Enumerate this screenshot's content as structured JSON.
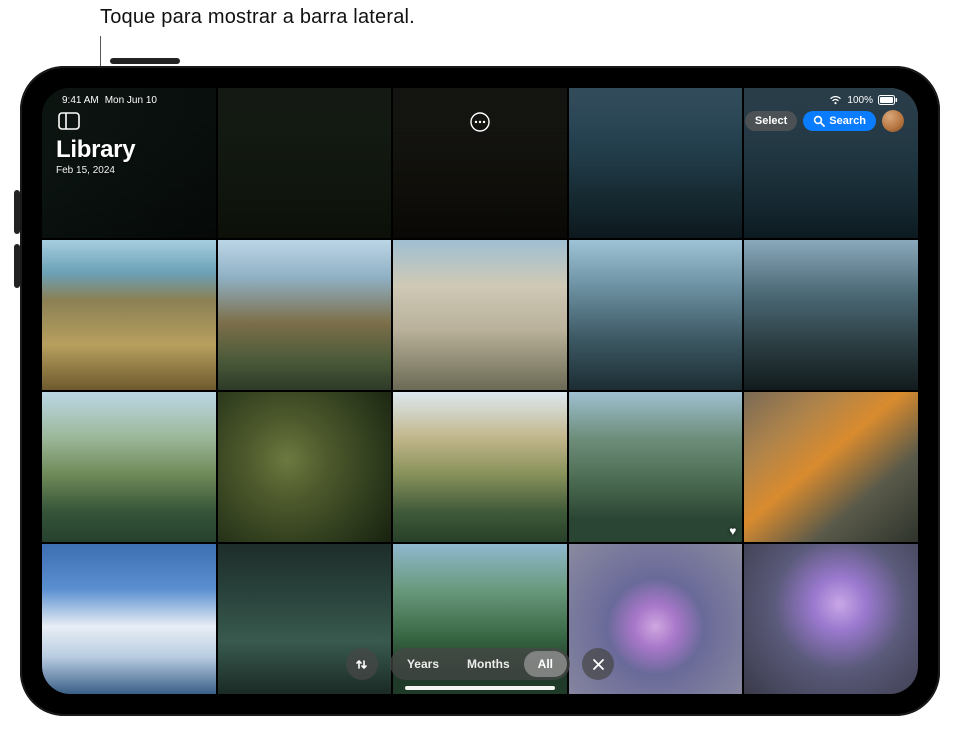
{
  "callout": {
    "text": "Toque para mostrar a barra lateral."
  },
  "statusbar": {
    "time": "9:41 AM",
    "date": "Mon Jun 10",
    "battery_pct": "100%"
  },
  "header": {
    "title": "Library",
    "subtitle": "Feb 15, 2024"
  },
  "top_controls": {
    "select_label": "Select",
    "search_label": "Search"
  },
  "segmented": {
    "years": "Years",
    "months": "Months",
    "all": "All",
    "active": "all"
  },
  "icons": {
    "sidebar": "sidebar-icon",
    "more": "ellipsis-circle-icon",
    "search": "magnifyingglass-icon",
    "sort": "arrow-up-down-icon",
    "close": "xmark-icon",
    "wifi": "wifi-icon",
    "battery": "battery-icon",
    "heart": "heart-fill-icon"
  },
  "grid": {
    "rows": 4,
    "cols": 5,
    "favorites": [
      13
    ]
  }
}
